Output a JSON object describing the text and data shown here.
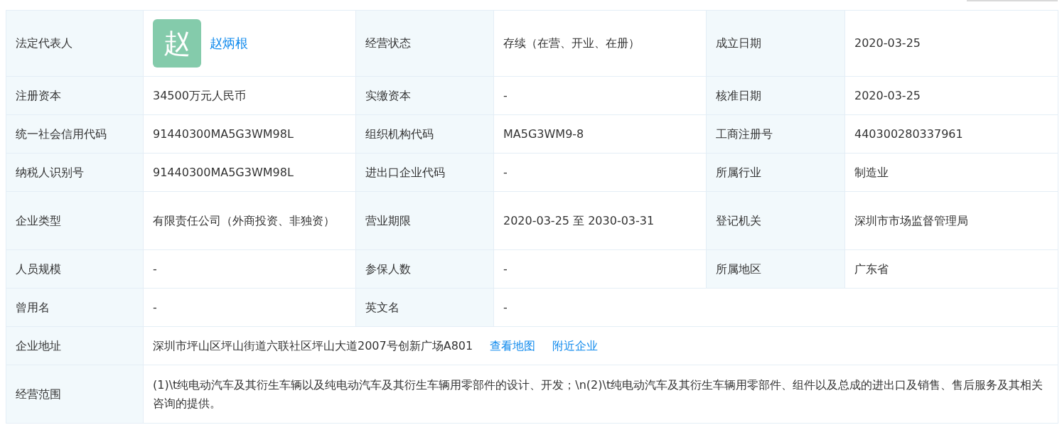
{
  "rows": [
    {
      "fields": [
        {
          "label": "法定代表人",
          "kind": "person",
          "avatar": "赵",
          "value": "赵炳根"
        },
        {
          "label": "经营状态",
          "kind": "text",
          "value": "存续（在营、开业、在册）"
        },
        {
          "label": "成立日期",
          "kind": "text",
          "value": "2020-03-25"
        }
      ]
    },
    {
      "fields": [
        {
          "label": "注册资本",
          "kind": "text",
          "value": "34500万元人民币"
        },
        {
          "label": "实缴资本",
          "kind": "text",
          "value": "-"
        },
        {
          "label": "核准日期",
          "kind": "text",
          "value": "2020-03-25"
        }
      ]
    },
    {
      "fields": [
        {
          "label": "统一社会信用代码",
          "kind": "text",
          "value": "91440300MA5G3WM98L"
        },
        {
          "label": "组织机构代码",
          "kind": "text",
          "value": "MA5G3WM9-8"
        },
        {
          "label": "工商注册号",
          "kind": "text",
          "value": "440300280337961"
        }
      ]
    },
    {
      "fields": [
        {
          "label": "纳税人识别号",
          "kind": "text",
          "value": "91440300MA5G3WM98L"
        },
        {
          "label": "进出口企业代码",
          "kind": "text",
          "value": "-"
        },
        {
          "label": "所属行业",
          "kind": "text",
          "value": "制造业"
        }
      ]
    },
    {
      "fields": [
        {
          "label": "企业类型",
          "kind": "text",
          "value": "有限责任公司（外商投资、非独资）"
        },
        {
          "label": "营业期限",
          "kind": "text",
          "value": "2020-03-25 至 2030-03-31"
        },
        {
          "label": "登记机关",
          "kind": "text",
          "value": "深圳市市场监督管理局"
        }
      ]
    },
    {
      "fields": [
        {
          "label": "人员规模",
          "kind": "text",
          "value": "-"
        },
        {
          "label": "参保人数",
          "kind": "text",
          "value": "-"
        },
        {
          "label": "所属地区",
          "kind": "text",
          "value": "广东省"
        }
      ]
    },
    {
      "fields": [
        {
          "label": "曾用名",
          "kind": "text",
          "value": "-"
        },
        {
          "label": "英文名",
          "kind": "text",
          "value": "-"
        }
      ]
    },
    {
      "fields": [
        {
          "label": "企业地址",
          "kind": "address",
          "value": "深圳市坪山区坪山街道六联社区坪山大道2007号创新广场A801",
          "links": [
            "查看地图",
            "附近企业"
          ]
        }
      ]
    },
    {
      "fields": [
        {
          "label": "经营范围",
          "kind": "text",
          "value": "(1)\\t纯电动汽车及其衍生车辆以及纯电动汽车及其衍生车辆用零部件的设计、开发；\\n(2)\\t纯电动汽车及其衍生车辆用零部件、组件以及总成的进出口及销售、售后服务及其相关咨询的提供。"
        }
      ]
    }
  ]
}
